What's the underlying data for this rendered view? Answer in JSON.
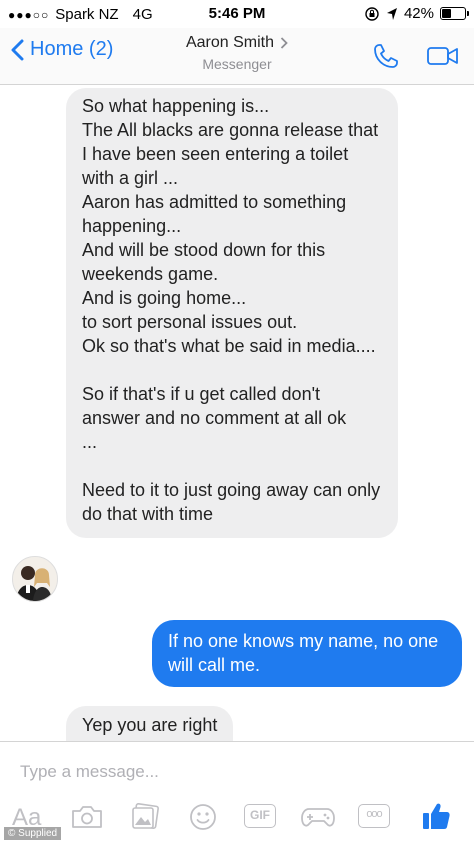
{
  "status_bar": {
    "carrier": "Spark NZ",
    "network": "4G",
    "time": "5:46 PM",
    "battery": "42%"
  },
  "header": {
    "back_label": "Home (2)",
    "contact_name": "Aaron Smith",
    "subtitle": "Messenger"
  },
  "messages": [
    {
      "direction": "incoming",
      "text": "So what happening is...\nThe All blacks are gonna release that I have been seen entering a toilet with a girl ...\nAaron has admitted to something happening...\nAnd will be stood down for this weekends game.\nAnd is going home...\nto sort personal issues out.\nOk so that's what be said in media....\n\nSo if that's if u get called don't answer and no comment at all ok\n...\n\nNeed to it to just going away can only do that with time"
    },
    {
      "direction": "outgoing",
      "text": "If no one knows my name, no one will call me."
    },
    {
      "direction": "incoming",
      "text": "Yep you are right"
    }
  ],
  "composer": {
    "placeholder": "Type a message...",
    "text_tool_label": "Aa",
    "gif_label": "GIF",
    "more_label": "ooo"
  },
  "watermark": "© Supplied",
  "colors": {
    "accent": "#1f7bef",
    "incoming_bubble": "#eeeeef",
    "toolbar_icon": "#c0c0c4"
  }
}
